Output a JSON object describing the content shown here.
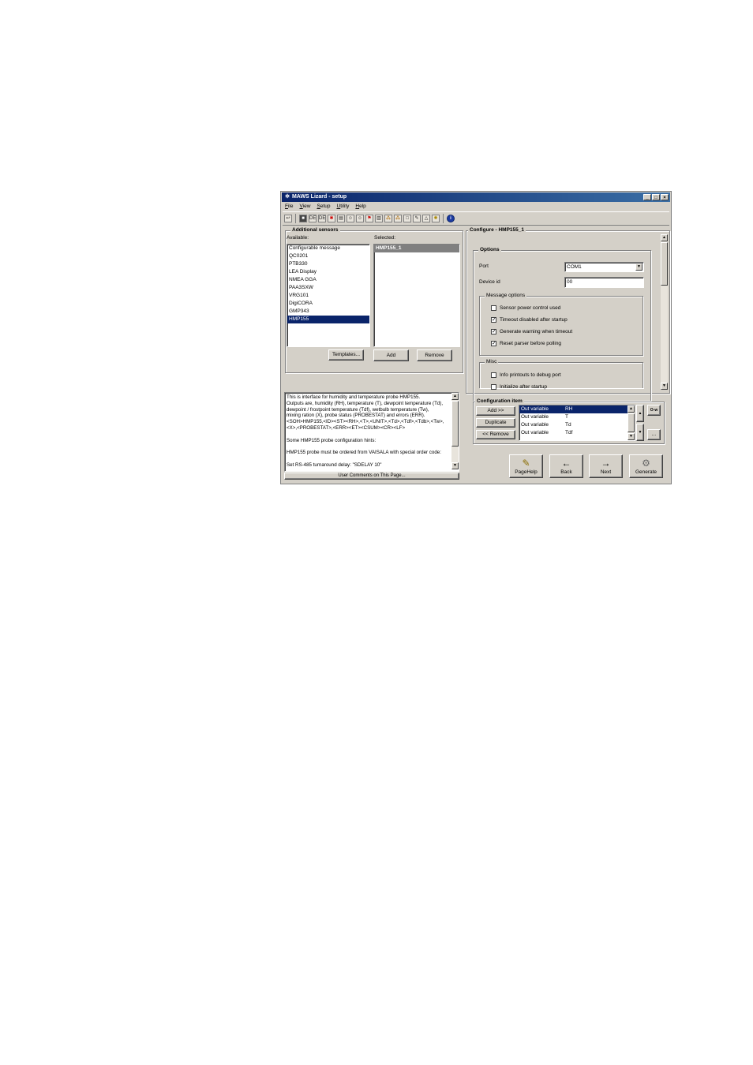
{
  "window": {
    "title": "MAWS Lizard - setup",
    "controls": {
      "minimize": "_",
      "maximize": "□",
      "close": "×"
    }
  },
  "menu": [
    "File",
    "View",
    "Setup",
    "Utility",
    "Help"
  ],
  "toolbar": {
    "icons": [
      "back-arrow-icon",
      "stop-icon",
      "dev-icon",
      "dev-icon",
      "sensor-icon",
      "grid-icon",
      "runner-icon",
      "runner-icon",
      "flag-icon",
      "tower-icon",
      "network-icon",
      "network-icon",
      "document-icon",
      "wrench-icon",
      "bell-icon",
      "gear-icon",
      "info-icon"
    ],
    "labels": {
      "dev1": "DEV",
      "dev2": "DEV"
    }
  },
  "additional_sensors": {
    "title": "Additional sensors",
    "available_label": "Available:",
    "selected_label": "Selected:",
    "available": [
      "Configurable message",
      "QC0201",
      "PTB330",
      "LEA Display",
      "NMEA GGA",
      "PAA3SXW",
      "VRG101",
      "DigiCORA",
      "GMP343",
      "HMP155"
    ],
    "available_selected": "HMP155",
    "selected": [
      "HMP155_1"
    ],
    "templates_button": "Templates...",
    "add_button": "Add",
    "remove_button": "Remove"
  },
  "description": {
    "lines": [
      "This is interface for humidity and temperature probe HMP155.",
      "Outputs are, humidity (RH), temperature (T), dewpoint temperature (Td),",
      "dewpoint / frostpoint temperature (Tdf), wetbulb temperature (Tw),",
      "mixing ration (X), probe status (PROBESTAT) and errors (ERR).",
      "<SOH>HMP155,<ID><ST><RH>,<T>,<UNIT>,<Td>,<Tdf>,<Tdb>,<Tw>,",
      "<X>,<PROBESTAT>,<ERR><ET><CSUM><CR><LF>",
      "",
      "Some HMP155 probe configuration hints:",
      "",
      "HMP155 probe must be ordered from VAISALA with special order code:",
      "",
      "Set RS-485 turnaround delay: \"SDELAY 10\""
    ],
    "footer_button": "User Comments on This Page..."
  },
  "configure": {
    "title": "Configure - HMP155_1",
    "options_title": "Options",
    "port_label": "Port",
    "port_value": "COM1",
    "device_id_label": "Device id",
    "device_id_value": "00",
    "message_options_title": "Message options",
    "message_options": [
      {
        "label": "Sensor power control used",
        "checked": false
      },
      {
        "label": "Timeout disabled after startup",
        "checked": true
      },
      {
        "label": "Generate warning when timeout",
        "checked": true
      },
      {
        "label": "Reset parser before polling",
        "checked": true
      }
    ],
    "misc_title": "Misc",
    "misc_options": [
      {
        "label": "Info printouts to debug port",
        "checked": false
      },
      {
        "label": "Initialize after startup",
        "checked": false
      }
    ],
    "check_mark": "✓"
  },
  "configuration_item": {
    "title": "Configuration item",
    "add_button": "Add >>",
    "duplicate_button": "Duplicate",
    "remove_button": "<< Remove",
    "rows": [
      {
        "type": "Out variable",
        "name": "RH"
      },
      {
        "type": "Out variable",
        "name": "T"
      },
      {
        "type": "Out variable",
        "name": "Td"
      },
      {
        "type": "Out variable",
        "name": "Tdf"
      }
    ],
    "up_arrow": "▲",
    "down_arrow": "▼",
    "key_label": "O-w",
    "more_label": "..."
  },
  "nav": {
    "pagehelp": "PageHelp",
    "back": "Back",
    "next": "Next",
    "generate": "Generate",
    "back_glyph": "←",
    "next_glyph": "→",
    "pagehelp_glyph": "✎",
    "generate_glyph": "⚙"
  }
}
